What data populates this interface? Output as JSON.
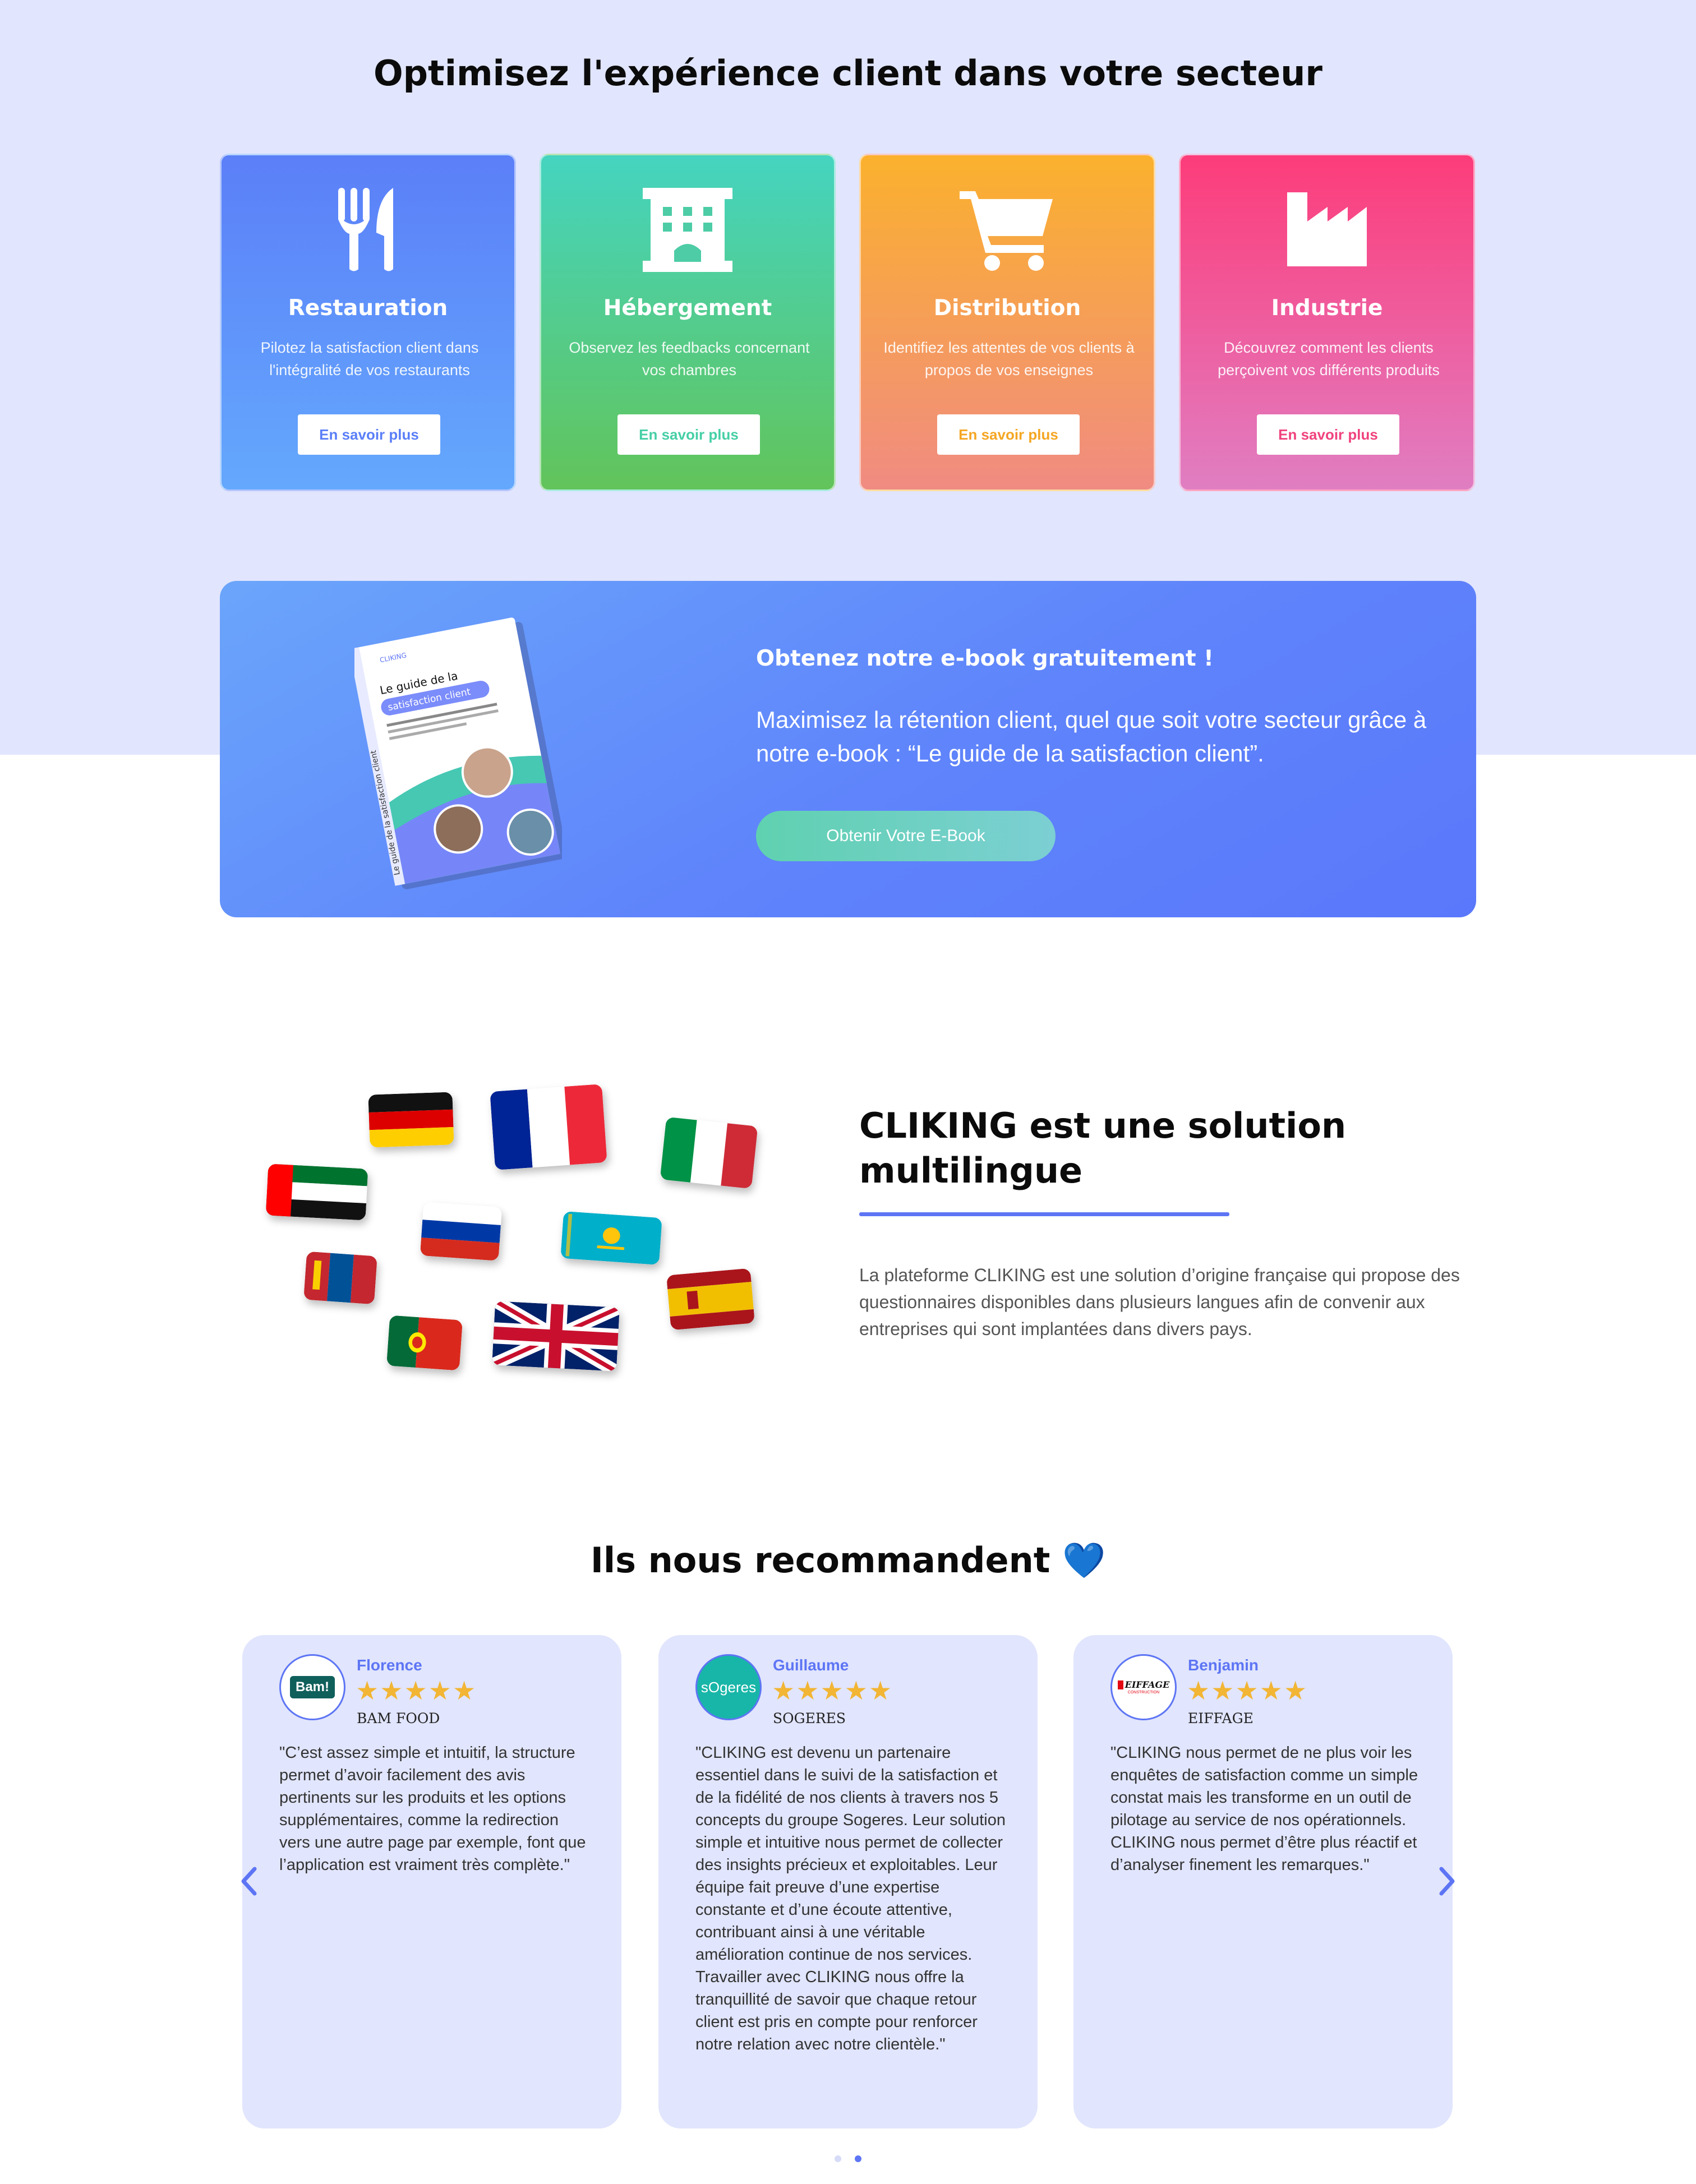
{
  "sectors": {
    "title": "Optimisez l'expérience client dans votre secteur",
    "cards": [
      {
        "title": "Restauration",
        "desc": "Pilotez la satisfaction client dans l'intégralité de vos restaurants",
        "button": "En savoir plus",
        "icon": "cutlery-icon",
        "color": "#5b7ff8"
      },
      {
        "title": "Hébergement",
        "desc": "Observez les feedbacks concernant vos chambres",
        "button": "En savoir plus",
        "icon": "hotel-icon",
        "color": "#3fcfa6"
      },
      {
        "title": "Distribution",
        "desc": "Identifiez les attentes de vos clients à propos de vos enseignes",
        "button": "En savoir plus",
        "icon": "cart-icon",
        "color": "#f8a53a"
      },
      {
        "title": "Industrie",
        "desc": "Découvrez comment les clients perçoivent vos différents produits",
        "button": "En savoir plus",
        "icon": "factory-icon",
        "color": "#f2457a"
      }
    ]
  },
  "ebook": {
    "title": "Obtenez notre e-book gratuitement !",
    "text": "Maximisez la rétention client, quel que soit votre secteur grâce à notre e-book : “Le guide de la satisfaction client”.",
    "button": "Obtenir Votre E-Book",
    "cover": {
      "brand": "CLIKING",
      "title_line1": "Le guide de la",
      "title_line2": "satisfaction client",
      "blurb": "Maximisez la rétention client, quel que soit votre secteur : Restauration, Industrie, Distribution, Immobilier, Hôtellerie, etc.",
      "spine": "Le guide de la satisfaction client"
    }
  },
  "multilingual": {
    "title": "CLIKING est une solution multilingue",
    "text": "La plateforme CLIKING est une solution d’origine française qui propose des questionnaires disponibles dans plusieurs langues afin de convenir aux entreprises qui sont implantées dans divers pays.",
    "flags": [
      "germany",
      "france",
      "italy",
      "uae",
      "russia",
      "kazakhstan",
      "mongolia",
      "spain",
      "portugal",
      "united-kingdom"
    ]
  },
  "reviews": {
    "title": "Ils nous recommandent",
    "title_emoji": "💙",
    "items": [
      {
        "name": "Florence",
        "stars": "★★★★★",
        "company": "BAM FOOD",
        "logo_text": "Bam!",
        "quote": "\"C’est assez simple et intuitif, la structure permet d’avoir facilement des avis pertinents sur les produits et les options supplémentaires, comme la redirection vers une autre page par exemple, font que l’application est vraiment très complète.\""
      },
      {
        "name": "Guillaume",
        "stars": "★★★★★",
        "company": "SOGERES",
        "logo_text": "sOgeres",
        "quote": "\"CLIKING est devenu un partenaire essentiel dans le suivi de la satisfaction et de la fidélité de nos clients à travers nos 5 concepts du groupe Sogeres. Leur solution simple et intuitive nous permet de collecter des insights précieux et exploitables. Leur équipe fait preuve d’une expertise constante et d’une écoute attentive, contribuant ainsi à une véritable amélioration continue de nos services. Travailler avec CLIKING nous offre la tranquillité de savoir que chaque retour client est pris en compte pour renforcer notre relation avec notre clientèle.\""
      },
      {
        "name": "Benjamin",
        "stars": "★★★★★",
        "company": "EIFFAGE",
        "logo_text": "EIFFAGE",
        "logo_subtext": "CONSTRUCTION",
        "quote": "\"CLIKING nous permet de ne plus voir les enquêtes de satisfaction comme un simple constat mais les transforme en un outil de pilotage au service de nos opérationnels. CLIKING nous permet d’être plus réactif et d’analyser finement les remarques.\""
      }
    ],
    "carousel_active_index": 1,
    "carousel_count": 2
  },
  "colors": {
    "accent": "#5d75f4",
    "background_top": "#e1e5fd",
    "star": "#f2b534"
  }
}
